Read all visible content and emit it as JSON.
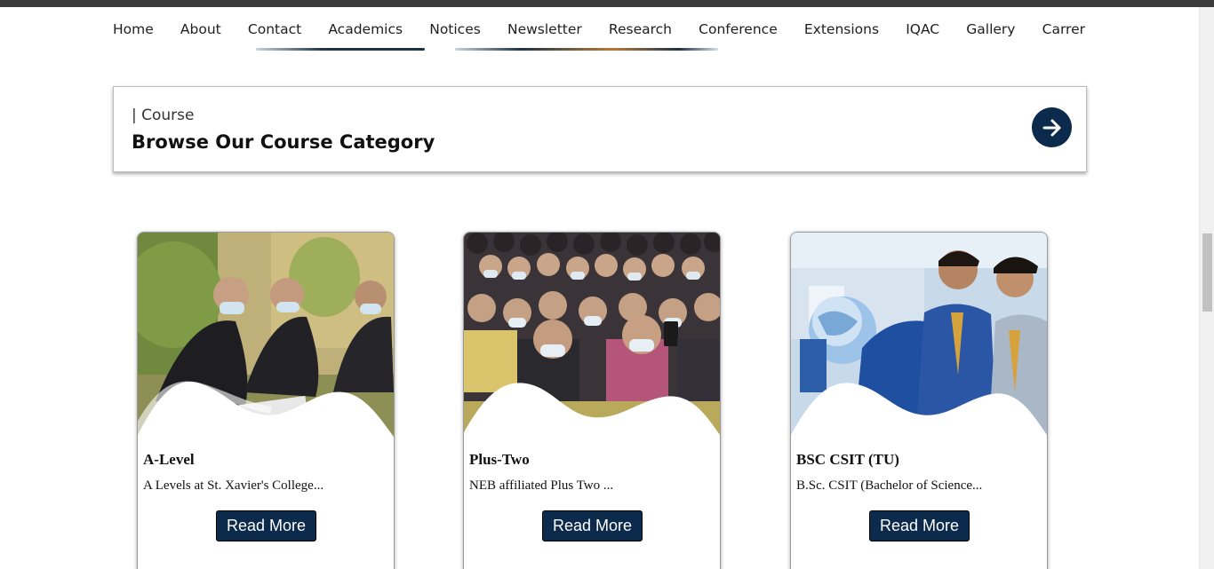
{
  "nav": {
    "items": [
      {
        "label": "Home"
      },
      {
        "label": "About"
      },
      {
        "label": "Contact"
      },
      {
        "label": "Academics"
      },
      {
        "label": "Notices"
      },
      {
        "label": "Newsletter"
      },
      {
        "label": "Research"
      },
      {
        "label": "Conference"
      },
      {
        "label": "Extensions"
      },
      {
        "label": "IQAC"
      },
      {
        "label": "Gallery"
      },
      {
        "label": "Carrer"
      }
    ]
  },
  "course_section": {
    "tag": "| Course",
    "heading": "Browse Our Course Category",
    "arrow_icon": "arrow-right-icon"
  },
  "cards": [
    {
      "title": "A-Level",
      "description": "A Levels at St. Xavier's College...",
      "button": "Read More",
      "image": "students-seated-outdoors-photo"
    },
    {
      "title": "Plus-Two",
      "description": "NEB affiliated Plus Two ...",
      "button": "Read More",
      "image": "student-crowd-photo"
    },
    {
      "title": "BSC CSIT (TU)",
      "description": "B.Sc. CSIT (Bachelor of Science...",
      "button": "Read More",
      "image": "students-with-globe-photo"
    }
  ],
  "colors": {
    "accent": "#0c2a4b",
    "topbar": "#3b3b3b"
  }
}
